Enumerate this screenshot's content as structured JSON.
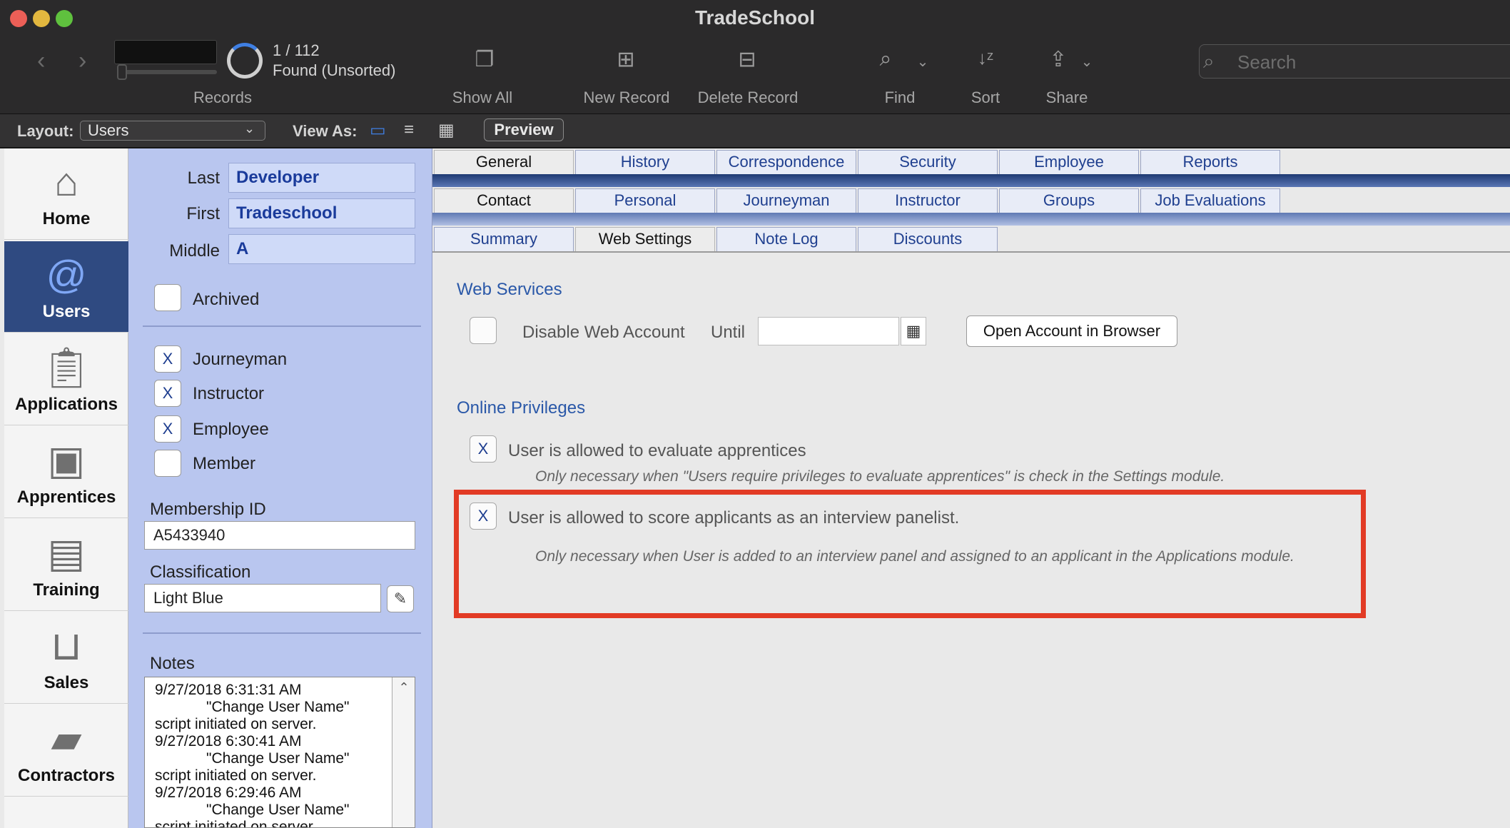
{
  "window": {
    "title": "TradeSchool"
  },
  "toolbar": {
    "records_count": "1 / 112",
    "records_status": "Found (Unsorted)",
    "records_label": "Records",
    "show_all_label": "Show All",
    "new_record_label": "New Record",
    "delete_record_label": "Delete Record",
    "find_label": "Find",
    "sort_label": "Sort",
    "share_label": "Share",
    "search_placeholder": "Search"
  },
  "layout_bar": {
    "layout_label": "Layout:",
    "layout_value": "Users",
    "view_as_label": "View As:",
    "preview_label": "Preview"
  },
  "nav": {
    "items": [
      {
        "label": "Home",
        "icon": "house-icon"
      },
      {
        "label": "Users",
        "icon": "address-book-icon",
        "active": true
      },
      {
        "label": "Applications",
        "icon": "clipboard-icon"
      },
      {
        "label": "Apprentices",
        "icon": "id-card-icon"
      },
      {
        "label": "Training",
        "icon": "certificate-icon"
      },
      {
        "label": "Sales",
        "icon": "shopping-basket-icon"
      },
      {
        "label": "Contractors",
        "icon": "briefcase-icon"
      }
    ]
  },
  "user": {
    "last_label": "Last",
    "last_value": "Developer",
    "first_label": "First",
    "first_value": "Tradeschool",
    "middle_label": "Middle",
    "middle_value": "A",
    "archived_label": "Archived",
    "archived_checked": "",
    "roles": [
      {
        "label": "Journeyman",
        "mark": "X"
      },
      {
        "label": "Instructor",
        "mark": "X"
      },
      {
        "label": "Employee",
        "mark": "X"
      },
      {
        "label": "Member",
        "mark": ""
      }
    ],
    "membership_id_label": "Membership ID",
    "membership_id_value": "A5433940",
    "classification_label": "Classification",
    "classification_value": "Light Blue",
    "notes_label": "Notes",
    "notes_lines": [
      "9/27/2018 6:31:31 AM",
      "\"Change User Name\"",
      "script initiated on server.",
      "9/27/2018 6:30:41 AM",
      "\"Change User Name\"",
      "script initiated on server.",
      "9/27/2018 6:29:46 AM",
      "\"Change User Name\"",
      "script initiated on server."
    ]
  },
  "tabs": {
    "row1": [
      "General",
      "History",
      "Correspondence",
      "Security",
      "Employee",
      "Reports"
    ],
    "row2": [
      "Contact",
      "Personal",
      "Journeyman",
      "Instructor",
      "Groups",
      "Job Evaluations"
    ],
    "row3": [
      "Summary",
      "Web Settings",
      "Note Log",
      "Discounts"
    ]
  },
  "web_settings": {
    "web_services_title": "Web Services",
    "disable_label": "Disable Web Account",
    "disable_mark": "",
    "until_label": "Until",
    "until_value": "",
    "open_account_button": "Open Account in Browser",
    "online_privileges_title": "Online Privileges",
    "evaluate_mark": "X",
    "evaluate_label": "User is allowed to evaluate apprentices",
    "evaluate_note": "Only necessary when \"Users require privileges to evaluate apprentices\" is check in the Settings module.",
    "score_mark": "X",
    "score_label": "User is allowed to score applicants as an interview panelist.",
    "score_note": "Only necessary when User is added to an interview panel and assigned to an applicant in the Applications module."
  },
  "colors": {
    "highlight": "#e23b25",
    "nav_active": "#2f4a81",
    "panel_blue": "#b9c6ef",
    "link_blue": "#2a58a8"
  }
}
